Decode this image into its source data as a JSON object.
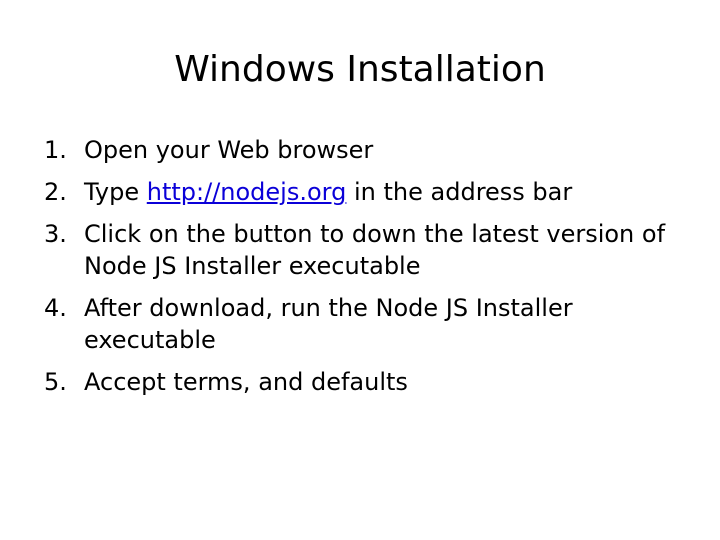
{
  "slide": {
    "title": "Windows Installation",
    "link_color": "#0b00d8",
    "steps": [
      {
        "number": "1.",
        "text": "Open your Web browser"
      },
      {
        "number": "2.",
        "before": "Type ",
        "link": "http://nodejs.org",
        "after": " in the address bar"
      },
      {
        "number": "3.",
        "text": "Click on the button to down the latest version of Node JS Installer executable"
      },
      {
        "number": "4.",
        "text": "After download, run the Node JS Installer executable"
      },
      {
        "number": "5.",
        "text": "Accept terms, and defaults"
      }
    ]
  }
}
